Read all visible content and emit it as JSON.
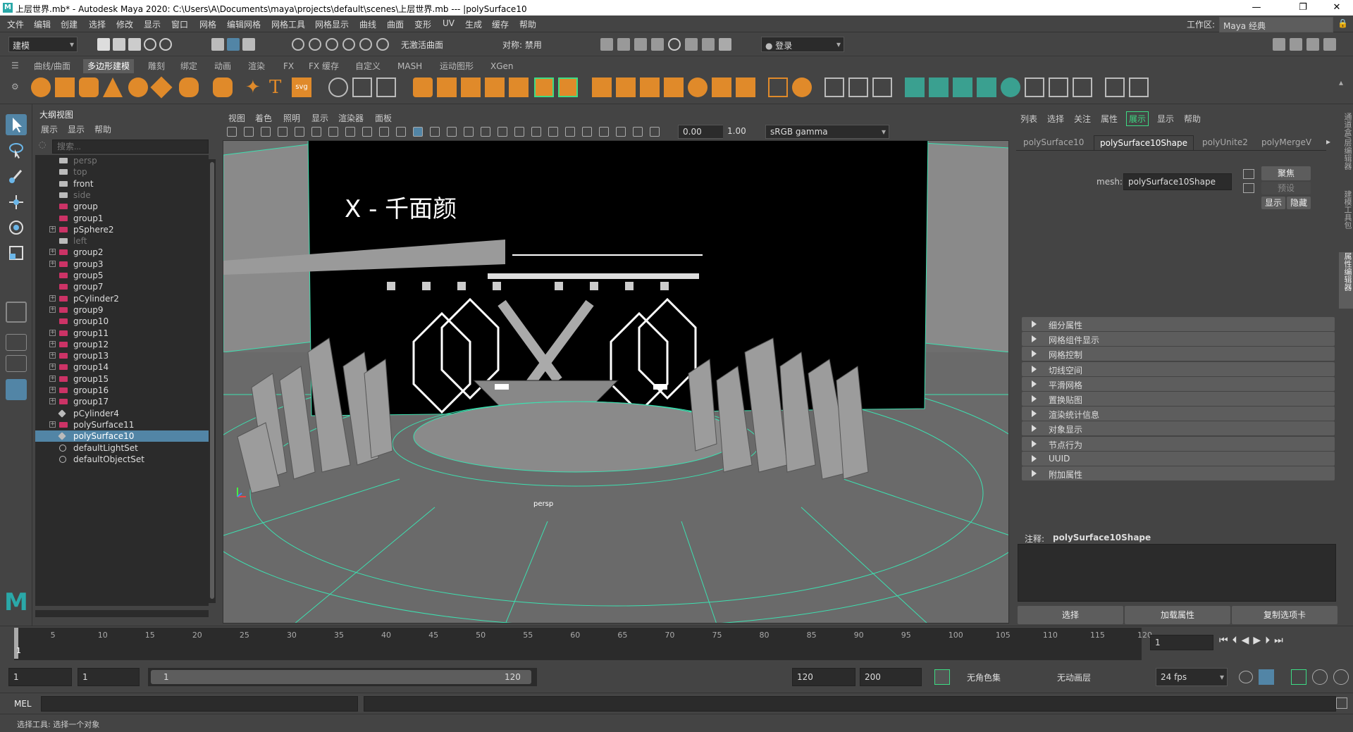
{
  "window": {
    "title": "上层世界.mb* - Autodesk Maya 2020: C:\\Users\\A\\Documents\\maya\\projects\\default\\scenes\\上层世界.mb   ---   |polySurface10",
    "logo": "M",
    "minimize": "—",
    "restore": "❐",
    "close": "✕"
  },
  "menu": {
    "items": [
      "文件",
      "编辑",
      "创建",
      "选择",
      "修改",
      "显示",
      "窗口",
      "网格",
      "编辑网格",
      "网格工具",
      "网格显示",
      "曲线",
      "曲面",
      "变形",
      "UV",
      "生成",
      "缓存",
      "帮助"
    ],
    "workspace_label": "工作区:",
    "workspace_value": "Maya 经典"
  },
  "statusline": {
    "mode": "建模",
    "no_live": "无激活曲面",
    "symmetry": "对称: 禁用",
    "login": "登录"
  },
  "shelf": {
    "tabs": [
      "曲线/曲面",
      "多边形建模",
      "雕刻",
      "绑定",
      "动画",
      "渲染",
      "FX",
      "FX 缓存",
      "自定义",
      "MASH",
      "运动图形",
      "XGen"
    ],
    "active": 1,
    "svg_label": "svg"
  },
  "outliner": {
    "title": "大纲视图",
    "menu": [
      "展示",
      "显示",
      "帮助"
    ],
    "search_placeholder": "搜索...",
    "rows": [
      {
        "label": "persp",
        "type": "cam",
        "dim": true,
        "exp": false
      },
      {
        "label": "top",
        "type": "cam",
        "dim": true,
        "exp": false
      },
      {
        "label": "front",
        "type": "cam",
        "dim": false,
        "exp": false
      },
      {
        "label": "side",
        "type": "cam",
        "dim": true,
        "exp": false
      },
      {
        "label": "group",
        "type": "grp",
        "dim": false,
        "exp": false
      },
      {
        "label": "group1",
        "type": "grp",
        "dim": false,
        "exp": false
      },
      {
        "label": "pSphere2",
        "type": "grp",
        "dim": false,
        "exp": true
      },
      {
        "label": "left",
        "type": "cam",
        "dim": true,
        "exp": false
      },
      {
        "label": "group2",
        "type": "grp",
        "dim": false,
        "exp": true
      },
      {
        "label": "group3",
        "type": "grp",
        "dim": false,
        "exp": true
      },
      {
        "label": "group5",
        "type": "grp",
        "dim": false,
        "exp": false
      },
      {
        "label": "group7",
        "type": "grp",
        "dim": false,
        "exp": false
      },
      {
        "label": "pCylinder2",
        "type": "grp",
        "dim": false,
        "exp": true
      },
      {
        "label": "group9",
        "type": "grp",
        "dim": false,
        "exp": true
      },
      {
        "label": "group10",
        "type": "grp",
        "dim": false,
        "exp": false
      },
      {
        "label": "group11",
        "type": "grp",
        "dim": false,
        "exp": true
      },
      {
        "label": "group12",
        "type": "grp",
        "dim": false,
        "exp": true
      },
      {
        "label": "group13",
        "type": "grp",
        "dim": false,
        "exp": true
      },
      {
        "label": "group14",
        "type": "grp",
        "dim": false,
        "exp": true
      },
      {
        "label": "group15",
        "type": "grp",
        "dim": false,
        "exp": true
      },
      {
        "label": "group16",
        "type": "grp",
        "dim": false,
        "exp": true
      },
      {
        "label": "group17",
        "type": "grp",
        "dim": false,
        "exp": true
      },
      {
        "label": "pCylinder4",
        "type": "mesh",
        "dim": false,
        "exp": false
      },
      {
        "label": "polySurface11",
        "type": "grp",
        "dim": false,
        "exp": true
      },
      {
        "label": "polySurface10",
        "type": "mesh",
        "dim": false,
        "exp": false,
        "sel": true
      },
      {
        "label": "defaultLightSet",
        "type": "set",
        "dim": false,
        "exp": false
      },
      {
        "label": "defaultObjectSet",
        "type": "set",
        "dim": false,
        "exp": false
      }
    ]
  },
  "viewport": {
    "menu": [
      "视图",
      "着色",
      "照明",
      "显示",
      "渲染器",
      "面板"
    ],
    "exposure": "0.00",
    "gamma": "1.00",
    "colorspace": "sRGB gamma",
    "screen_text": "X - 千面颜",
    "camera_label": "persp"
  },
  "attr": {
    "menu": [
      "列表",
      "选择",
      "关注",
      "属性",
      "展示",
      "显示",
      "帮助"
    ],
    "tabs": [
      "polySurface10",
      "polySurface10Shape",
      "polyUnite2",
      "polyMergeV"
    ],
    "active_tab": 1,
    "mesh_label": "mesh:",
    "mesh_value": "polySurface10Shape",
    "focus_btn": "聚焦",
    "preset_btn": "预设",
    "show_btn": "显示",
    "hide_btn": "隐藏",
    "sections": [
      "细分属性",
      "网格组件显示",
      "网格控制",
      "切线空间",
      "平滑网格",
      "置换贴图",
      "渲染统计信息",
      "对象显示",
      "节点行为",
      "UUID",
      "附加属性"
    ],
    "note_label": "注释:",
    "note_value": "polySurface10Shape",
    "bottom_buttons": [
      "选择",
      "加载属性",
      "复制选项卡"
    ]
  },
  "side_tabs": [
    "通道盒/层编辑器",
    "建模工具包",
    "属性编辑器"
  ],
  "timeline": {
    "ticks": [
      "5",
      "10",
      "15",
      "20",
      "25",
      "30",
      "35",
      "40",
      "45",
      "50",
      "55",
      "60",
      "65",
      "70",
      "75",
      "80",
      "85",
      "90",
      "95",
      "100",
      "105",
      "110",
      "115",
      "120"
    ],
    "first": "1",
    "current": "1"
  },
  "range": {
    "start": "1",
    "start2": "1",
    "slider_start": "1",
    "slider_end": "120",
    "end": "120",
    "end2": "200",
    "charset": "无角色集",
    "animlayer": "无动画层",
    "fps": "24 fps"
  },
  "mel": {
    "label": "MEL"
  },
  "help": {
    "text": "选择工具: 选择一个对象"
  }
}
